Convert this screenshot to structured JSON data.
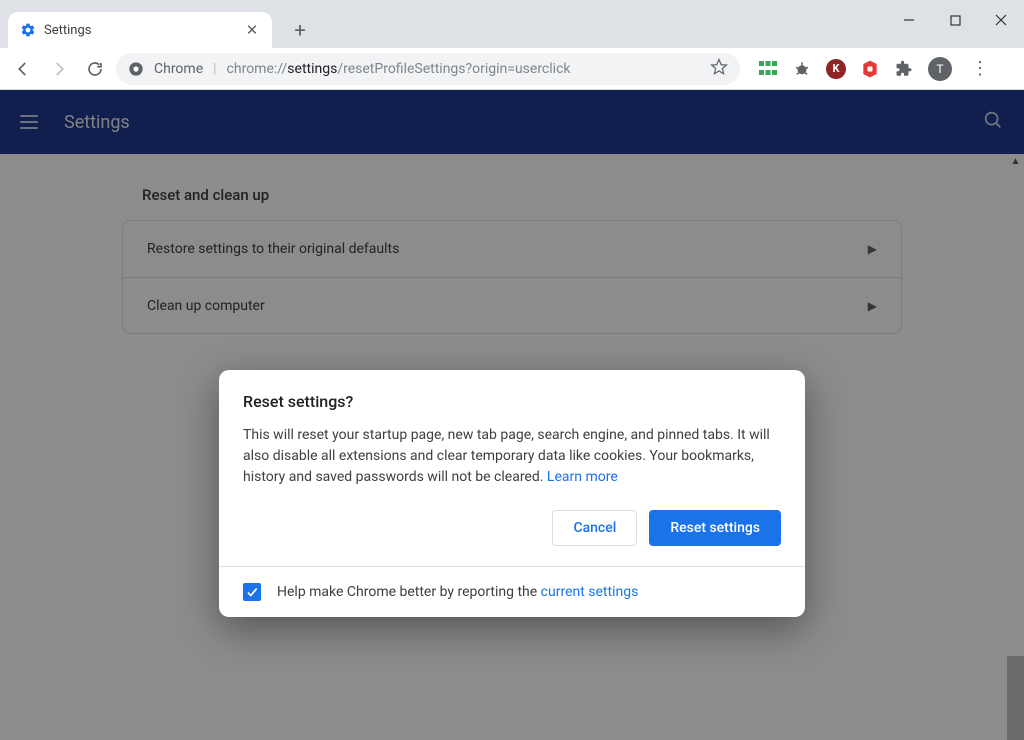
{
  "tab": {
    "title": "Settings"
  },
  "window_controls": {
    "minimize": "–",
    "maximize": "□",
    "close": "×"
  },
  "omnibox": {
    "prefix": "Chrome",
    "url_display_host": "chrome://",
    "url_display_path_strong": "settings",
    "url_display_path_rest": "/resetProfileSettings?origin=userclick"
  },
  "extensions": [
    {
      "name": "ext-grid",
      "color": "#34a853",
      "glyph": ""
    },
    {
      "name": "ext-bug",
      "color": "#5f6368",
      "glyph": "🐞"
    },
    {
      "name": "ext-k",
      "color": "#a02222",
      "glyph": "K"
    },
    {
      "name": "ext-shield",
      "color": "#e53935",
      "glyph": "✋"
    },
    {
      "name": "ext-puzzle",
      "color": "#5f6368",
      "glyph": ""
    }
  ],
  "avatar_letter": "T",
  "app_bar": {
    "title": "Settings"
  },
  "section": {
    "title": "Reset and clean up",
    "rows": [
      {
        "label": "Restore settings to their original defaults"
      },
      {
        "label": "Clean up computer"
      }
    ]
  },
  "dialog": {
    "title": "Reset settings?",
    "body": "This will reset your startup page, new tab page, search engine, and pinned tabs. It will also disable all extensions and clear temporary data like cookies. Your bookmarks, history and saved passwords will not be cleared. ",
    "learn_more": "Learn more",
    "cancel": "Cancel",
    "confirm": "Reset settings",
    "footer_text": "Help make Chrome better by reporting the ",
    "footer_link": "current settings",
    "checkbox_checked": true
  }
}
